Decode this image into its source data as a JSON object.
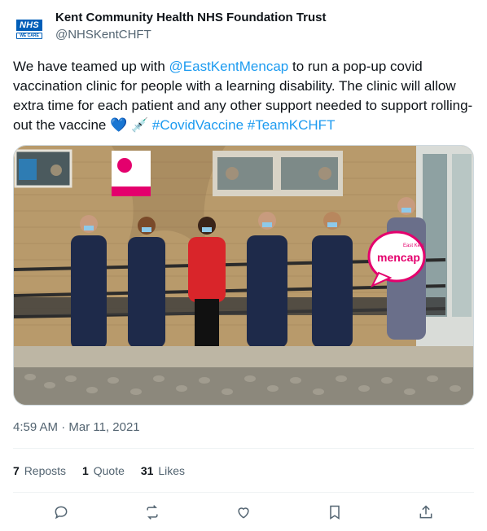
{
  "author": {
    "display_name": "Kent Community Health NHS Foundation Trust",
    "handle": "@NHSKentCHFT",
    "avatar_text": "NHS",
    "avatar_subtext": "WE CARE"
  },
  "tweet": {
    "text_1": "We have teamed up with ",
    "mention": "@EastKentMencap",
    "text_2": " to run a pop-up covid vaccination clinic for people with a learning disability. The clinic will allow extra time for each patient and any other support needed to support rolling-out the vaccine ",
    "emoji_heart": "💙",
    "emoji_syringe": "💉",
    "hashtag_1": "#CovidVaccine",
    "hashtag_2": "#TeamKCHFT",
    "photo_sign_text": "mencap",
    "photo_sign_small": "East Kent"
  },
  "timestamp": "4:59 AM · Mar 11, 2021",
  "stats": {
    "reposts_count": "7",
    "reposts_label": "Reposts",
    "quotes_count": "1",
    "quotes_label": "Quote",
    "likes_count": "31",
    "likes_label": "Likes"
  },
  "actions": [
    "reply-icon",
    "repost-icon",
    "like-icon",
    "bookmark-icon",
    "share-icon"
  ],
  "colors": {
    "link": "#1d9bf0",
    "nhs_blue": "#005eb8",
    "mencap_pink": "#e4006d",
    "secondary_text": "#536471"
  }
}
